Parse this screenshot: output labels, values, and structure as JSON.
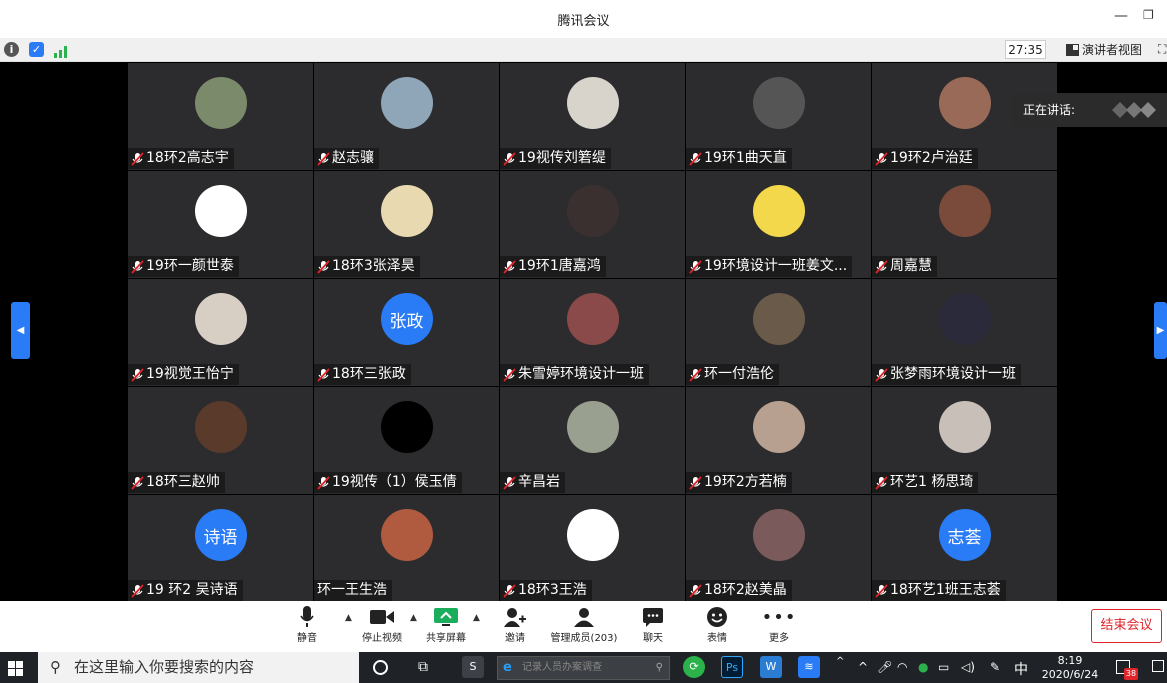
{
  "window": {
    "title": "腾讯会议",
    "minimize": "—",
    "restore": "❐"
  },
  "infobar": {
    "timer": "27:35",
    "speaker_view": "演讲者视图"
  },
  "speaking": {
    "label": "正在讲话:"
  },
  "participants": [
    {
      "name": "18环2高志宇",
      "avatar_text": "",
      "avatar_color": "#7a8a6a",
      "muted": true
    },
    {
      "name": "赵志骧",
      "avatar_text": "",
      "avatar_color": "#8fa6b8",
      "muted": true
    },
    {
      "name": "19视传刘箬缇",
      "avatar_text": "",
      "avatar_color": "#d8d4cc",
      "muted": true
    },
    {
      "name": "19环1曲天直",
      "avatar_text": "",
      "avatar_color": "#555555",
      "muted": true
    },
    {
      "name": "19环2卢治廷",
      "avatar_text": "",
      "avatar_color": "#9a6a58",
      "muted": true
    },
    {
      "name": "19环一颜世泰",
      "avatar_text": "",
      "avatar_color": "#ffffff",
      "muted": true
    },
    {
      "name": "18环3张泽昊",
      "avatar_text": "",
      "avatar_color": "#e8d9b0",
      "muted": true
    },
    {
      "name": "19环1唐嘉鸿",
      "avatar_text": "",
      "avatar_color": "#3a3030",
      "muted": true
    },
    {
      "name": "19环境设计一班姜文...",
      "avatar_text": "",
      "avatar_color": "#f2d84a",
      "muted": true
    },
    {
      "name": "周嘉慧",
      "avatar_text": "",
      "avatar_color": "#7a4a3a",
      "muted": true
    },
    {
      "name": "19视觉王怡宁",
      "avatar_text": "",
      "avatar_color": "#d8cfc4",
      "muted": true
    },
    {
      "name": "18环三张政",
      "avatar_text": "张政",
      "avatar_color": "#2a7cf6",
      "muted": true
    },
    {
      "name": "朱雪婷环境设计一班",
      "avatar_text": "",
      "avatar_color": "#8a4a4a",
      "muted": true
    },
    {
      "name": "环一付浩伦",
      "avatar_text": "",
      "avatar_color": "#6a5a4a",
      "muted": true
    },
    {
      "name": "张梦雨环境设计一班",
      "avatar_text": "",
      "avatar_color": "#2a2a3a",
      "muted": true
    },
    {
      "name": "18环三赵帅",
      "avatar_text": "",
      "avatar_color": "#5a3a2a",
      "muted": true
    },
    {
      "name": "19视传（1）侯玉倩",
      "avatar_text": "",
      "avatar_color": "#000000",
      "muted": true
    },
    {
      "name": "辛昌岩",
      "avatar_text": "",
      "avatar_color": "#9aa090",
      "muted": true
    },
    {
      "name": "19环2方若楠",
      "avatar_text": "",
      "avatar_color": "#b8a090",
      "muted": true
    },
    {
      "name": "环艺1 杨思琦",
      "avatar_text": "",
      "avatar_color": "#c8c0b8",
      "muted": true
    },
    {
      "name": "19 环2 吴诗语",
      "avatar_text": "诗语",
      "avatar_color": "#2a7cf6",
      "muted": true
    },
    {
      "name": "环一王生浩",
      "avatar_text": "",
      "avatar_color": "#b05a40",
      "muted": false
    },
    {
      "name": "18环3王浩",
      "avatar_text": "",
      "avatar_color": "#ffffff",
      "muted": true
    },
    {
      "name": "18环2赵美晶",
      "avatar_text": "",
      "avatar_color": "#7a5a5a",
      "muted": true
    },
    {
      "name": "18环艺1班王志荟",
      "avatar_text": "志荟",
      "avatar_color": "#2a7cf6",
      "muted": true
    }
  ],
  "toolbar": {
    "mute": "静音",
    "stop_video": "停止视频",
    "share_screen": "共享屏幕",
    "invite": "邀请",
    "manage_members": "管理成员(203)",
    "chat": "聊天",
    "emoji": "表情",
    "more": "更多",
    "end_meeting": "结束会议"
  },
  "taskbar": {
    "search_placeholder": "在这里输入你要搜索的内容",
    "ie_address": "记录人员办案调查",
    "ps_label": "Ps",
    "ime": "中",
    "time": "8:19",
    "date": "2020/6/24",
    "notification_count": "38"
  }
}
